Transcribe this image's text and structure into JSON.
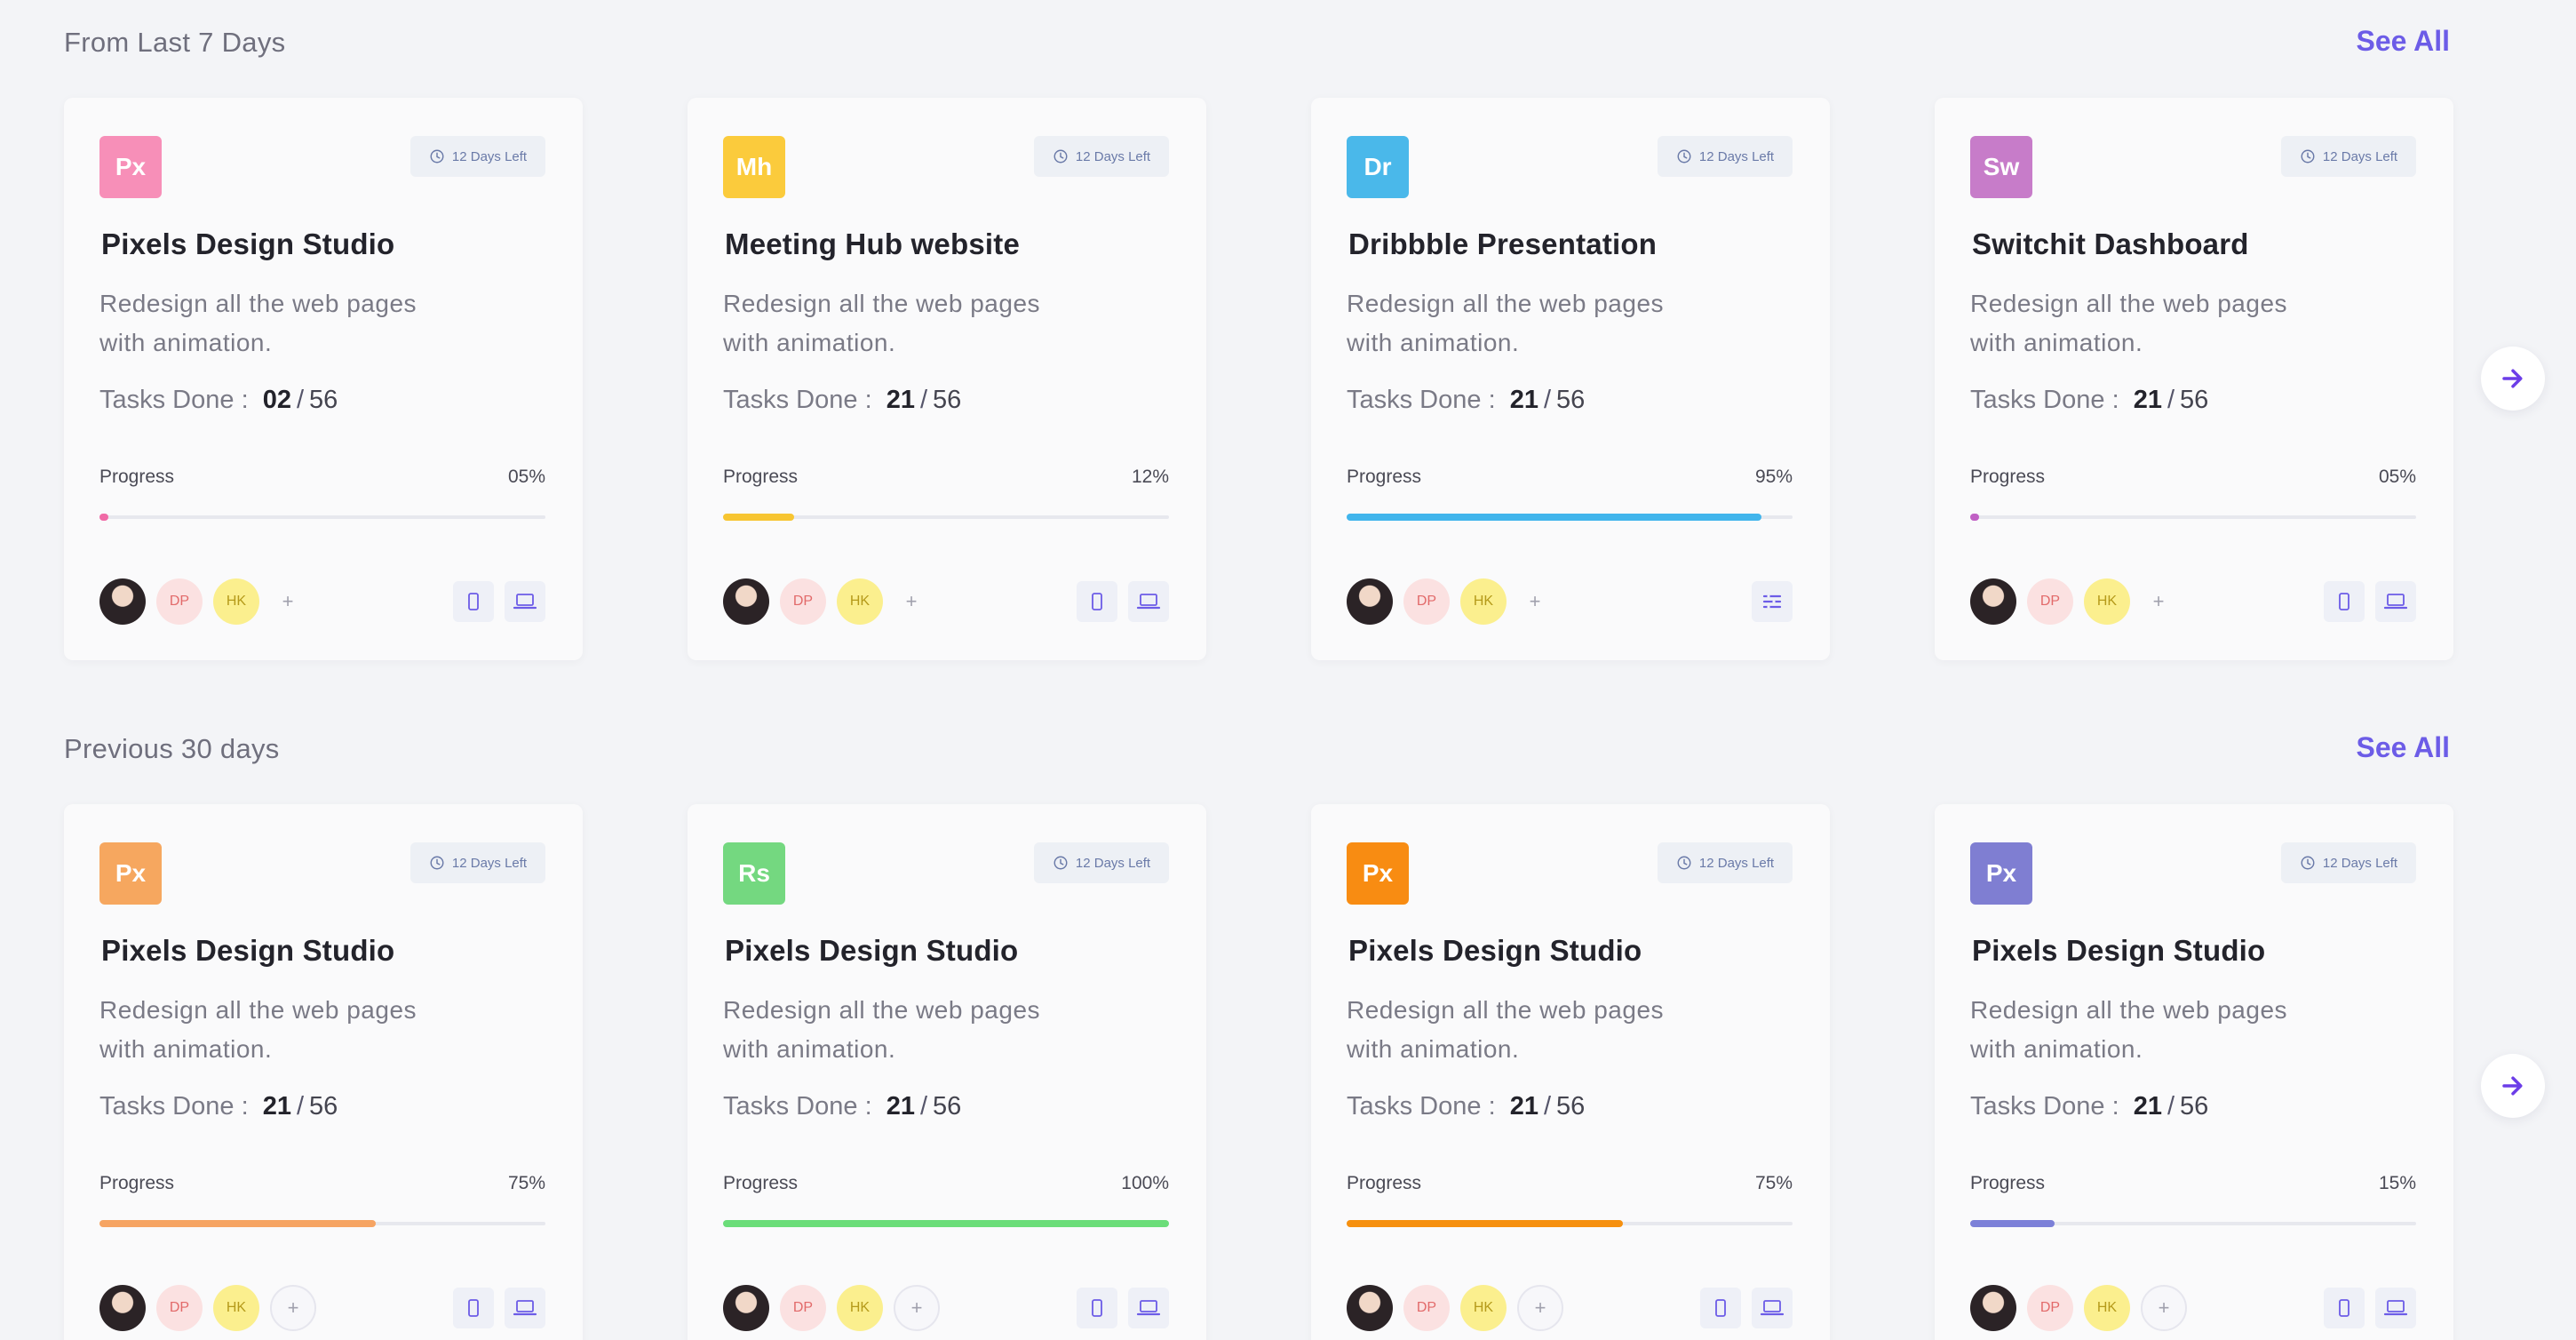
{
  "sections": [
    {
      "title": "From Last 7 Days",
      "see_all": "See All",
      "cards": [
        {
          "icon_text": "Px",
          "icon_color": "#f78fb8",
          "days_left": "12 Days Left",
          "title": "Pixels Design Studio",
          "desc_line1": "Redesign all the web pages",
          "desc_line2": "with animation.",
          "tasks_label": "Tasks Done :",
          "tasks_done": "02",
          "tasks_total": "56",
          "progress_label": "Progress",
          "progress_text": "05%",
          "progress": 0.02,
          "bar_color": "#f06aa6",
          "more": "+",
          "devices": [
            "phone-icon",
            "laptop-icon"
          ]
        },
        {
          "icon_text": "Mh",
          "icon_color": "#fbcb3c",
          "days_left": "12 Days Left",
          "title": "Meeting Hub website",
          "desc_line1": "Redesign all the web pages",
          "desc_line2": "with animation.",
          "tasks_label": "Tasks Done :",
          "tasks_done": "21",
          "tasks_total": "56",
          "progress_label": "Progress",
          "progress_text": "12%",
          "progress": 0.16,
          "bar_color": "#f7c531",
          "more": "+",
          "devices": [
            "phone-icon",
            "laptop-icon"
          ]
        },
        {
          "icon_text": "Dr",
          "icon_color": "#4ab8ea",
          "days_left": "12 Days Left",
          "title": "Dribbble Presentation",
          "desc_line1": "Redesign all the web pages",
          "desc_line2": "with animation.",
          "tasks_label": "Tasks Done :",
          "tasks_done": "21",
          "tasks_total": "56",
          "progress_label": "Progress",
          "progress_text": "95%",
          "progress": 0.93,
          "bar_color": "#41b5ec",
          "more": "+",
          "devices": [
            "list-icon"
          ]
        },
        {
          "icon_text": "Sw",
          "icon_color": "#c77cc9",
          "days_left": "12 Days Left",
          "title": "Switchit Dashboard",
          "desc_line1": "Redesign all the web pages",
          "desc_line2": "with animation.",
          "tasks_label": "Tasks Done :",
          "tasks_done": "21",
          "tasks_total": "56",
          "progress_label": "Progress",
          "progress_text": "05%",
          "progress": 0.02,
          "bar_color": "#c060c4",
          "more": "+",
          "devices": [
            "phone-icon",
            "laptop-icon"
          ]
        }
      ]
    },
    {
      "title": "Previous 30 days",
      "see_all": "See All",
      "cards": [
        {
          "icon_text": "Px",
          "icon_color": "#f6a75f",
          "days_left": "12 Days Left",
          "title": "Pixels Design Studio",
          "desc_line1": "Redesign all the web pages",
          "desc_line2": "with animation.",
          "tasks_label": "Tasks Done :",
          "tasks_done": "21",
          "tasks_total": "56",
          "progress_label": "Progress",
          "progress_text": "75%",
          "progress": 0.62,
          "bar_color": "#f6a463",
          "more": "+",
          "devices": [
            "phone-icon",
            "laptop-icon"
          ]
        },
        {
          "icon_text": "Rs",
          "icon_color": "#74d880",
          "days_left": "12 Days Left",
          "title": "Pixels Design Studio",
          "desc_line1": "Redesign all the web pages",
          "desc_line2": "with animation.",
          "tasks_label": "Tasks Done :",
          "tasks_done": "21",
          "tasks_total": "56",
          "progress_label": "Progress",
          "progress_text": "100%",
          "progress": 1.0,
          "bar_color": "#6bdd79",
          "more": "+",
          "devices": [
            "phone-icon",
            "laptop-icon"
          ]
        },
        {
          "icon_text": "Px",
          "icon_color": "#f88c12",
          "days_left": "12 Days Left",
          "title": "Pixels Design Studio",
          "desc_line1": "Redesign all the web pages",
          "desc_line2": "with animation.",
          "tasks_label": "Tasks Done :",
          "tasks_done": "21",
          "tasks_total": "56",
          "progress_label": "Progress",
          "progress_text": "75%",
          "progress": 0.62,
          "bar_color": "#f6900f",
          "more": "+",
          "devices": [
            "phone-icon",
            "laptop-icon"
          ]
        },
        {
          "icon_text": "Px",
          "icon_color": "#7f7ed2",
          "days_left": "12 Days Left",
          "title": "Pixels Design Studio",
          "desc_line1": "Redesign all the web pages",
          "desc_line2": "with animation.",
          "tasks_label": "Tasks Done :",
          "tasks_done": "21",
          "tasks_total": "56",
          "progress_label": "Progress",
          "progress_text": "15%",
          "progress": 0.19,
          "bar_color": "#7c80d8",
          "more": "+",
          "devices": [
            "phone-icon",
            "laptop-icon"
          ]
        }
      ]
    }
  ],
  "avatars": {
    "dp": "DP",
    "hk": "HK"
  },
  "accent": "#6c5ce7"
}
